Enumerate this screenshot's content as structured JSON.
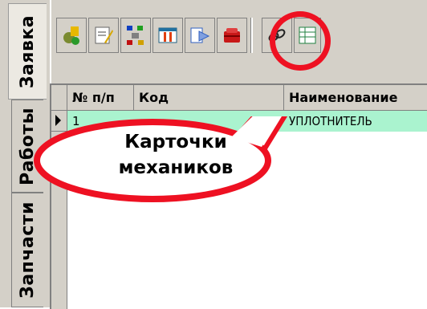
{
  "tabs": [
    "Заявка",
    "Работы",
    "Запчасти"
  ],
  "toolbar": {
    "buttons": [
      "add-icon",
      "edit-icon",
      "tree-icon",
      "columns-icon",
      "export-icon",
      "mechanic-cards-icon",
      "link-icon",
      "table-icon"
    ]
  },
  "grid": {
    "columns": [
      "№ п/п",
      "Код",
      "Наименование"
    ],
    "rows": [
      {
        "num": "1",
        "code": "",
        "name": "УПЛОТНИТЕЛЬ"
      }
    ]
  },
  "annotation": {
    "line1": "Карточки",
    "line2": "механиков",
    "color": "#ee1122"
  }
}
